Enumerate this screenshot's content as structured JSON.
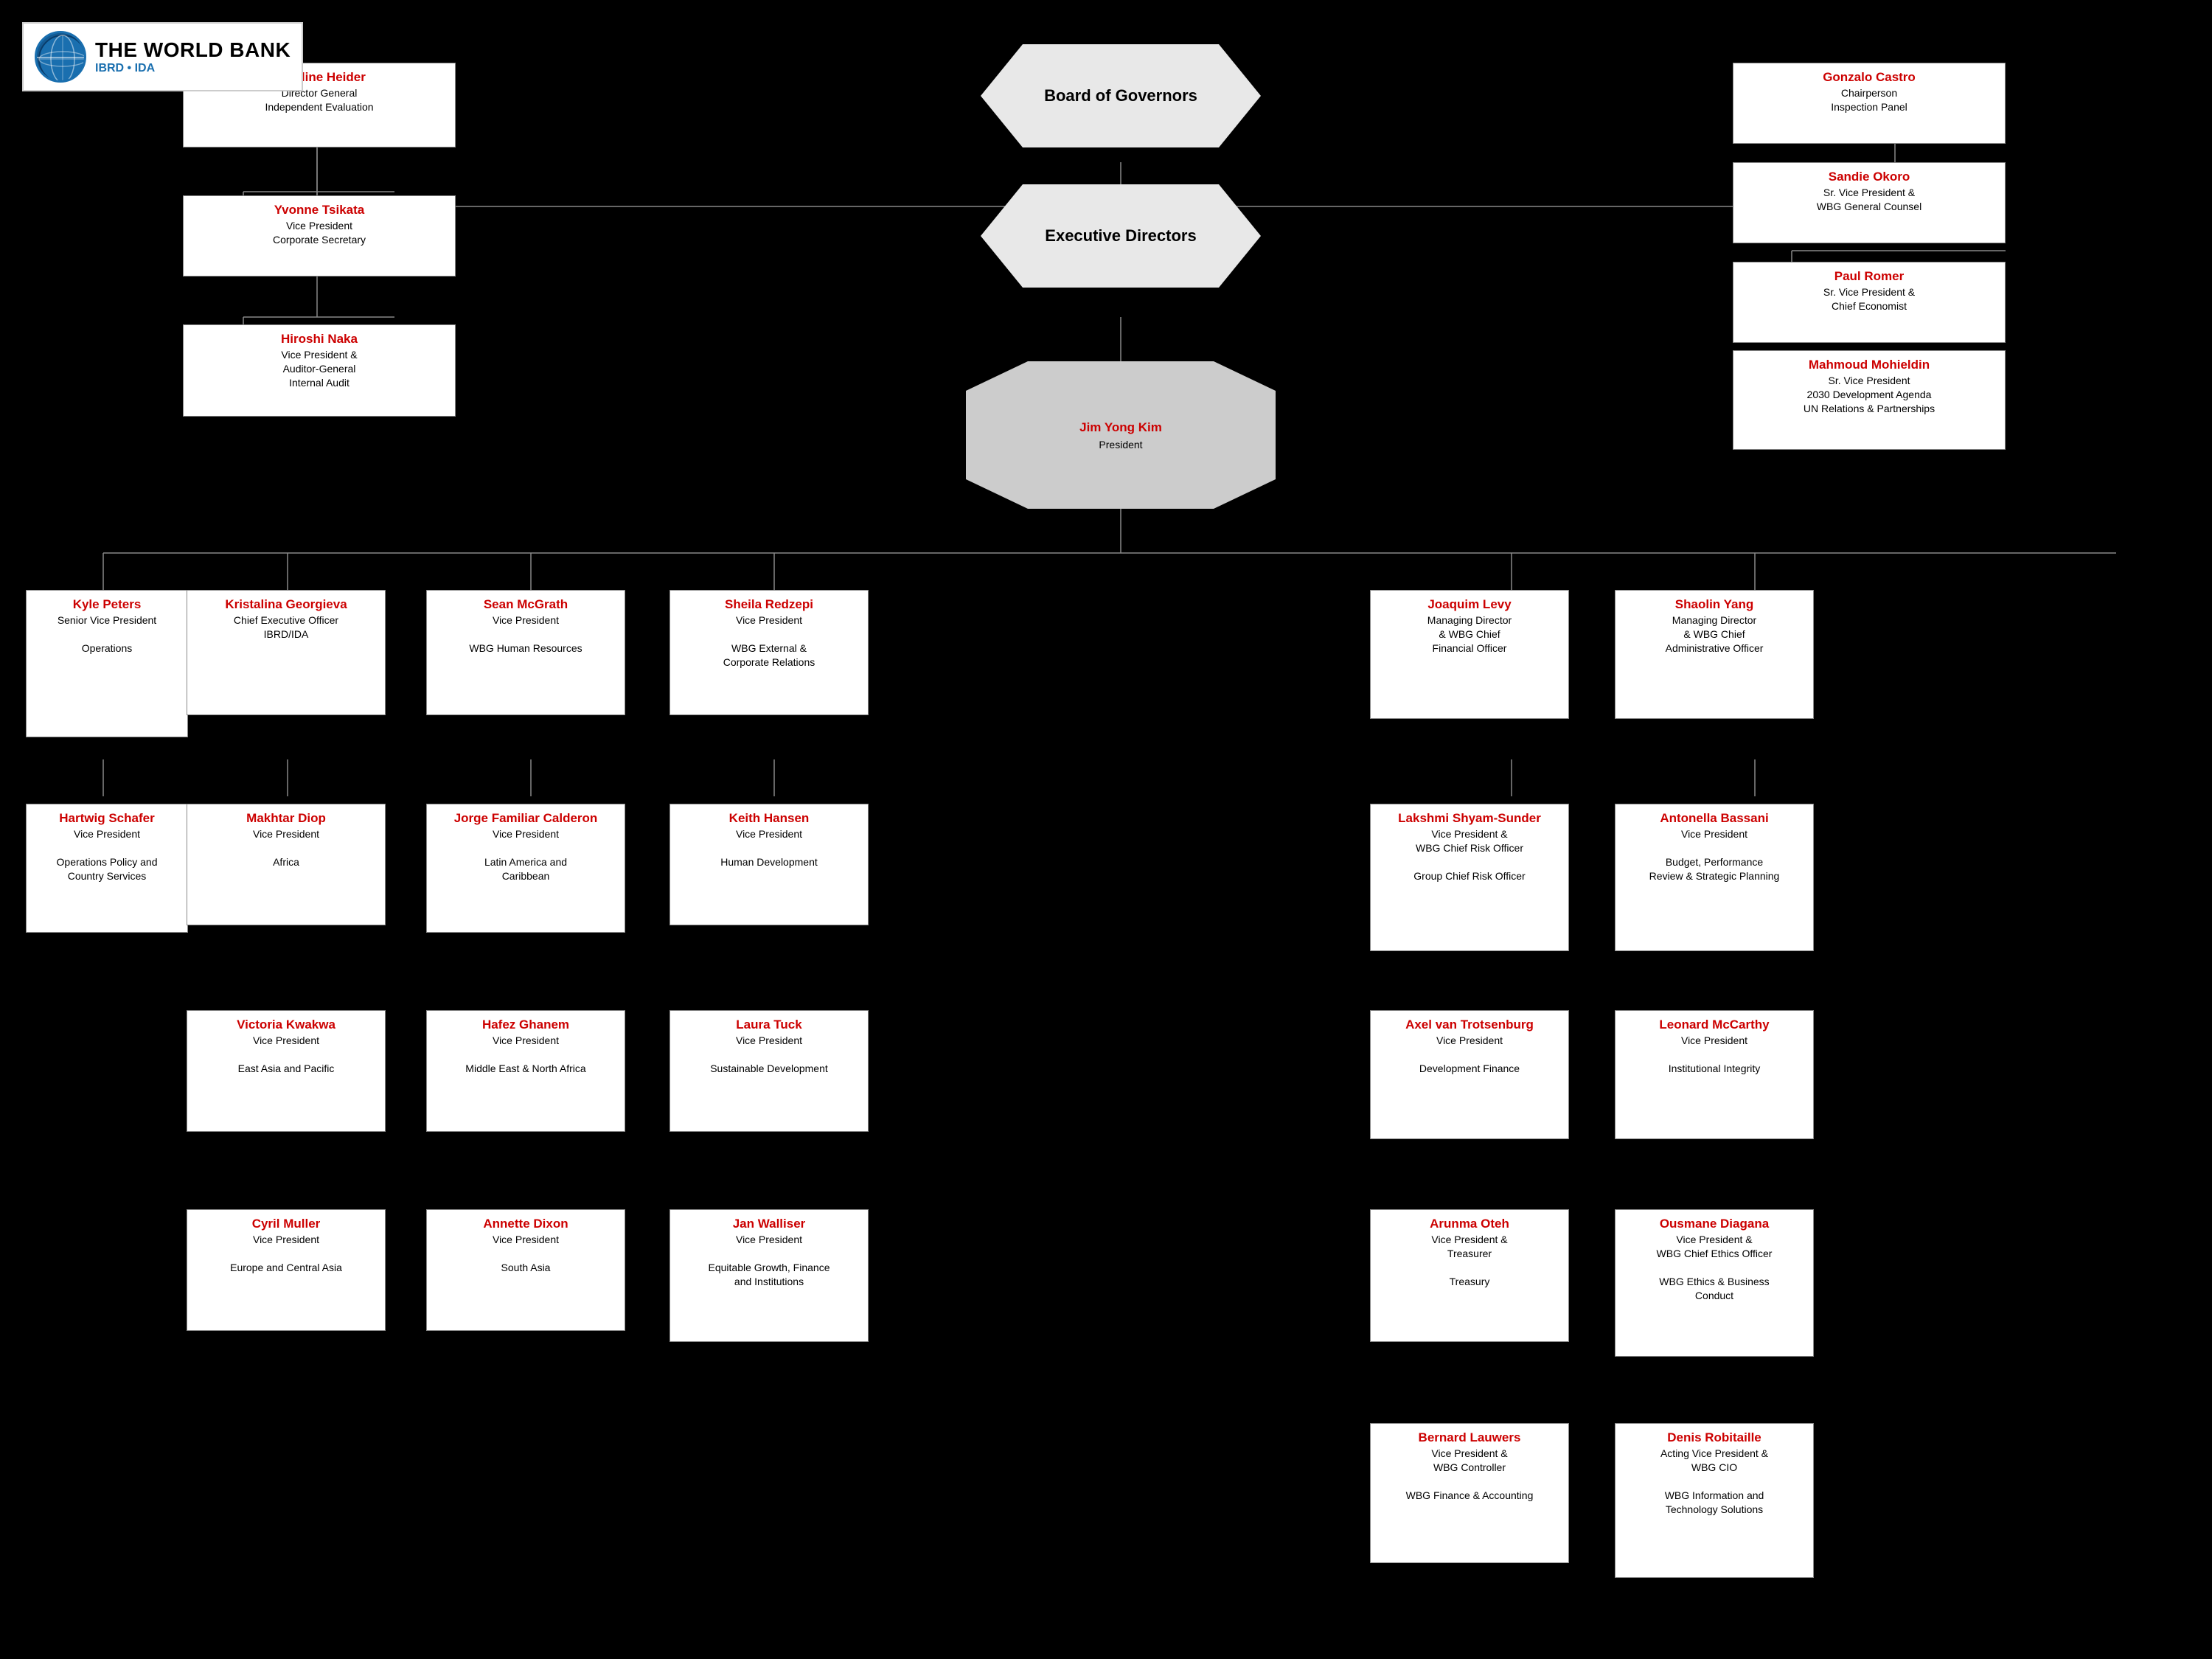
{
  "logo": {
    "line1": "THE WORLD BANK",
    "line2": "IBRD • IDA"
  },
  "board": {
    "label": "Board of Governors"
  },
  "exec_directors": {
    "label": "Executive Directors"
  },
  "president": {
    "name": "Jim Yong Kim",
    "title": "President"
  },
  "boxes": {
    "caroline": {
      "name": "Caroline Heider",
      "title": "Director General\nIndependent Evaluation"
    },
    "gonzalo": {
      "name": "Gonzalo Castro",
      "title": "Chairperson\nInspection Panel"
    },
    "yvonne": {
      "name": "Yvonne Tsikata",
      "title": "Vice President\nCorporate Secretary"
    },
    "sandie": {
      "name": "Sandie Okoro",
      "title": "Sr. Vice President &\nWBG General Counsel"
    },
    "hiroshi": {
      "name": "Hiroshi Naka",
      "title": "Vice President &\nAuditor-General\nInternal Audit"
    },
    "paul": {
      "name": "Paul Romer",
      "title": "Sr. Vice President &\nChief Economist"
    },
    "mahmoud": {
      "name": "Mahmoud Mohieldin",
      "title": "Sr. Vice President\n2030 Development Agenda\nUN Relations & Partnerships"
    },
    "kyle": {
      "name": "Kyle Peters",
      "title": "Senior Vice President\n\nOperations"
    },
    "kristalina": {
      "name": "Kristalina Georgieva",
      "title": "Chief Executive Officer\nIBRD/IDA"
    },
    "sean": {
      "name": "Sean McGrath",
      "title": "Vice President\n\nWBG Human Resources"
    },
    "sheila": {
      "name": "Sheila Redzepi",
      "title": "Vice President\n\nWBG External &\nCorporate Relations"
    },
    "joaquim": {
      "name": "Joaquim Levy",
      "title": "Managing Director\n& WBG Chief\nFinancial Officer"
    },
    "shaolin": {
      "name": "Shaolin Yang",
      "title": "Managing Director\n& WBG Chief\nAdministrative Officer"
    },
    "hartwig": {
      "name": "Hartwig Schafer",
      "title": "Vice President\n\nOperations Policy and\nCountry Services"
    },
    "makhtar": {
      "name": "Makhtar Diop",
      "title": "Vice President\n\nAfrica"
    },
    "jorge": {
      "name": "Jorge Familiar Calderon",
      "title": "Vice President\n\nLatin America and\nCaribbean"
    },
    "keith": {
      "name": "Keith Hansen",
      "title": "Vice President\n\nHuman Development"
    },
    "lakshmi": {
      "name": "Lakshmi Shyam-Sunder",
      "title": "Vice President &\nWBG Chief Risk Officer\n\nGroup Chief Risk Officer"
    },
    "antonella": {
      "name": "Antonella Bassani",
      "title": "Vice President\n\nBudget, Performance\nReview & Strategic Planning"
    },
    "victoria": {
      "name": "Victoria Kwakwa",
      "title": "Vice President\n\nEast Asia and Pacific"
    },
    "hafez": {
      "name": "Hafez Ghanem",
      "title": "Vice President\n\nMiddle East & North Africa"
    },
    "laura": {
      "name": "Laura Tuck",
      "title": "Vice President\n\nSustainable Development"
    },
    "axel": {
      "name": "Axel van Trotsenburg",
      "title": "Vice President\n\nDevelopment Finance"
    },
    "leonard": {
      "name": "Leonard McCarthy",
      "title": "Vice President\n\nInstitutional Integrity"
    },
    "cyril": {
      "name": "Cyril Muller",
      "title": "Vice President\n\nEurope and Central Asia"
    },
    "annette": {
      "name": "Annette Dixon",
      "title": "Vice President\n\nSouth Asia"
    },
    "jan": {
      "name": "Jan Walliser",
      "title": "Vice President\n\nEquitable Growth, Finance\nand Institutions"
    },
    "arunma": {
      "name": "Arunma Oteh",
      "title": "Vice President &\nTreasurer\n\nTreasury"
    },
    "ousmane": {
      "name": "Ousmane Diagana",
      "title": "Vice President  &\nWBG Chief Ethics Officer\n\nWBG Ethics & Business\nConduct"
    },
    "bernard": {
      "name": "Bernard Lauwers",
      "title": "Vice President &\nWBG Controller\n\nWBG Finance & Accounting"
    },
    "denis": {
      "name": "Denis Robitaille",
      "title": "Acting Vice President &\nWBG CIO\n\nWBG Information and\nTechnology Solutions"
    }
  }
}
